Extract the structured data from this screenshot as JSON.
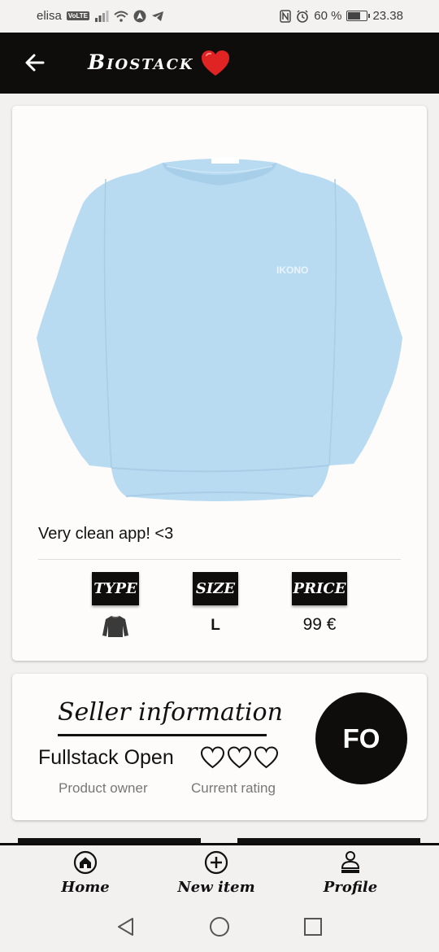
{
  "status_bar": {
    "carrier": "elisa",
    "volte": "VoLTE",
    "battery": "60 %",
    "battery_level": 0.6,
    "time": "23.38"
  },
  "app_bar": {
    "title": "Biostack",
    "back_icon": "arrow-left-icon",
    "title_icon": "red-heart-icon",
    "background": "#0e0d0b"
  },
  "product": {
    "image_icon": "sweatshirt-image",
    "description": "Very clean app! <3",
    "attributes": {
      "type_label": "TYPE",
      "type_icon": "sweatshirt-icon",
      "size_label": "SIZE",
      "size_value": "L",
      "price_label": "PRICE",
      "price_value": "99 €"
    }
  },
  "seller": {
    "heading": "Seller information",
    "name": "Fullstack Open",
    "role": "Product owner",
    "rating_label": "Current rating",
    "rating_value": 0,
    "rating_max": 3,
    "avatar_initials": "FO"
  },
  "bottom_nav": {
    "items": [
      {
        "label": "Home",
        "icon": "home-icon"
      },
      {
        "label": "New item",
        "icon": "plus-circle-icon"
      },
      {
        "label": "Profile",
        "icon": "user-icon"
      }
    ]
  },
  "system_nav": {
    "back": "triangle-back-icon",
    "home": "circle-home-icon",
    "recents": "square-recents-icon"
  }
}
